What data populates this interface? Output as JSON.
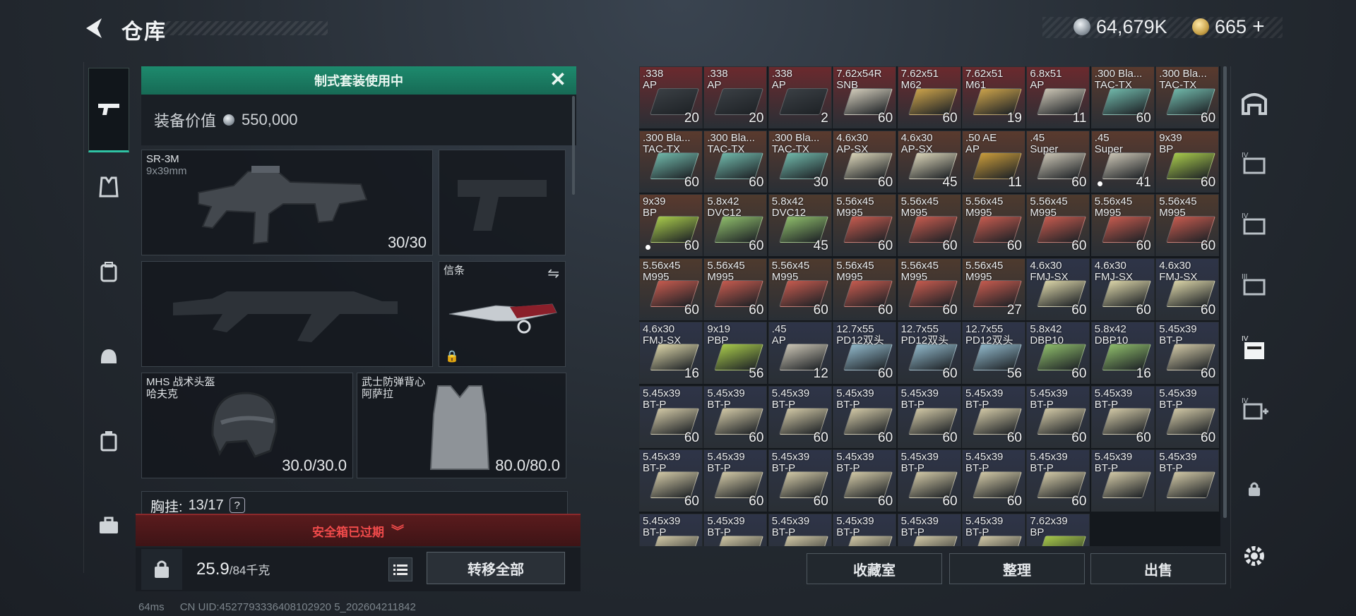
{
  "header": {
    "title": "仓库"
  },
  "currency": {
    "silver": "64,679K",
    "gold": "665",
    "gold_plus": "+"
  },
  "loadout": {
    "banner": "制式套装使用中",
    "value_label": "装备价值",
    "value": "550,000",
    "primary": {
      "name": "SR-3M",
      "caliber": "9x39mm",
      "count": "30/30"
    },
    "melee_label": "信条",
    "helmet": {
      "name": "MHS 战术头盔",
      "sub": "哈夫克",
      "durability": "30.0/30.0"
    },
    "armor": {
      "name": "武士防弹背心",
      "sub": "阿萨拉",
      "durability": "80.0/80.0"
    },
    "rig": {
      "label": "胸挂:",
      "value": "13/17",
      "help": "?"
    },
    "secure_case": "安全箱已过期",
    "weight": "25.9",
    "weight_max": "/84千克",
    "transfer_all": "转移全部"
  },
  "stash": {
    "items": [
      {
        "cal": ".338",
        "typ": "AP",
        "qty": "20",
        "color": "#3a3f44",
        "bg": "#6b2a2e"
      },
      {
        "cal": ".338",
        "typ": "AP",
        "qty": "20",
        "color": "#3a3f44",
        "bg": "#6b2a2e"
      },
      {
        "cal": ".338",
        "typ": "AP",
        "qty": "2",
        "color": "#3a3f44",
        "bg": "#6b2a2e"
      },
      {
        "cal": "7.62x54R",
        "typ": "SNB",
        "qty": "60",
        "color": "#cfc9b8",
        "bg": "#6b2a2e"
      },
      {
        "cal": "7.62x51",
        "typ": "M62",
        "qty": "60",
        "color": "#c9a14a",
        "bg": "#6b2a2e"
      },
      {
        "cal": "7.62x51",
        "typ": "M61",
        "qty": "19",
        "color": "#c9a14a",
        "bg": "#6b2a2e"
      },
      {
        "cal": "6.8x51",
        "typ": "AP",
        "qty": "11",
        "color": "#c8c2b2",
        "bg": "#6b2a2e"
      },
      {
        "cal": ".300 Bla...",
        "typ": "TAC-TX",
        "qty": "60",
        "color": "#6fb6a8",
        "bg": "#5a3a2e"
      },
      {
        "cal": ".300 Bla...",
        "typ": "TAC-TX",
        "qty": "60",
        "color": "#6fb6a8",
        "bg": "#5a3a2e"
      },
      {
        "cal": ".300 Bla...",
        "typ": "TAC-TX",
        "qty": "60",
        "color": "#6fb6a8",
        "bg": "#5a3a2e"
      },
      {
        "cal": ".300 Bla...",
        "typ": "TAC-TX",
        "qty": "60",
        "color": "#6fb6a8",
        "bg": "#5a3a2e"
      },
      {
        "cal": ".300 Bla...",
        "typ": "TAC-TX",
        "qty": "30",
        "color": "#6fb6a8",
        "bg": "#5a3a2e"
      },
      {
        "cal": "4.6x30",
        "typ": "AP-SX",
        "qty": "60",
        "color": "#d8d2b6",
        "bg": "#5a3a2e"
      },
      {
        "cal": "4.6x30",
        "typ": "AP-SX",
        "qty": "45",
        "color": "#d8d2b6",
        "bg": "#5a3a2e"
      },
      {
        "cal": ".50 AE",
        "typ": "AP",
        "qty": "11",
        "color": "#c79a3a",
        "bg": "#5a3a2e"
      },
      {
        "cal": ".45",
        "typ": "Super",
        "qty": "60",
        "color": "#c8c2b2",
        "bg": "#5a3a2e"
      },
      {
        "cal": ".45",
        "typ": "Super",
        "qty": "41",
        "color": "#c8c2b2",
        "bg": "#5a3a2e",
        "dot": true
      },
      {
        "cal": "9x39",
        "typ": "BP",
        "qty": "60",
        "color": "#a6c84a",
        "bg": "#5a3a2e"
      },
      {
        "cal": "9x39",
        "typ": "BP",
        "qty": "60",
        "color": "#a6c84a",
        "bg": "#5a3a2e",
        "dot": true
      },
      {
        "cal": "5.8x42",
        "typ": "DVC12",
        "qty": "60",
        "color": "#8dbb6a",
        "bg": "#4e3a2e"
      },
      {
        "cal": "5.8x42",
        "typ": "DVC12",
        "qty": "45",
        "color": "#8dbb6a",
        "bg": "#4e3a2e"
      },
      {
        "cal": "5.56x45",
        "typ": "M995",
        "qty": "60",
        "color": "#c45a4e",
        "bg": "#4e3a2e"
      },
      {
        "cal": "5.56x45",
        "typ": "M995",
        "qty": "60",
        "color": "#c45a4e",
        "bg": "#4e3a2e"
      },
      {
        "cal": "5.56x45",
        "typ": "M995",
        "qty": "60",
        "color": "#c45a4e",
        "bg": "#4e3a2e"
      },
      {
        "cal": "5.56x45",
        "typ": "M995",
        "qty": "60",
        "color": "#c45a4e",
        "bg": "#4e3a2e"
      },
      {
        "cal": "5.56x45",
        "typ": "M995",
        "qty": "60",
        "color": "#c45a4e",
        "bg": "#4e3a2e"
      },
      {
        "cal": "5.56x45",
        "typ": "M995",
        "qty": "60",
        "color": "#c45a4e",
        "bg": "#4e3a2e"
      },
      {
        "cal": "5.56x45",
        "typ": "M995",
        "qty": "60",
        "color": "#c45a4e",
        "bg": "#4e3a2e"
      },
      {
        "cal": "5.56x45",
        "typ": "M995",
        "qty": "60",
        "color": "#c45a4e",
        "bg": "#4e3a2e"
      },
      {
        "cal": "5.56x45",
        "typ": "M995",
        "qty": "60",
        "color": "#c45a4e",
        "bg": "#4e3a2e"
      },
      {
        "cal": "5.56x45",
        "typ": "M995",
        "qty": "60",
        "color": "#c45a4e",
        "bg": "#4e3a2e"
      },
      {
        "cal": "5.56x45",
        "typ": "M995",
        "qty": "60",
        "color": "#c45a4e",
        "bg": "#4e3a2e"
      },
      {
        "cal": "5.56x45",
        "typ": "M995",
        "qty": "27",
        "color": "#c45a4e",
        "bg": "#4e3a2e"
      },
      {
        "cal": "4.6x30",
        "typ": "FMJ-SX",
        "qty": "60",
        "color": "#d8d2a6",
        "bg": "#2e3448"
      },
      {
        "cal": "4.6x30",
        "typ": "FMJ-SX",
        "qty": "60",
        "color": "#d8d2a6",
        "bg": "#2e3448"
      },
      {
        "cal": "4.6x30",
        "typ": "FMJ-SX",
        "qty": "60",
        "color": "#d8d2a6",
        "bg": "#2e3448"
      },
      {
        "cal": "4.6x30",
        "typ": "FMJ-SX",
        "qty": "16",
        "color": "#d8d2a6",
        "bg": "#2e3448"
      },
      {
        "cal": "9x19",
        "typ": "PBP",
        "qty": "56",
        "color": "#a6c84a",
        "bg": "#2e3448"
      },
      {
        "cal": ".45",
        "typ": "AP",
        "qty": "12",
        "color": "#c8c2b2",
        "bg": "#2e3448"
      },
      {
        "cal": "12.7x55",
        "typ": "PD12双头",
        "qty": "60",
        "color": "#8fb6c8",
        "bg": "#2e3448"
      },
      {
        "cal": "12.7x55",
        "typ": "PD12双头",
        "qty": "60",
        "color": "#8fb6c8",
        "bg": "#2e3448"
      },
      {
        "cal": "12.7x55",
        "typ": "PD12双头",
        "qty": "56",
        "color": "#8fb6c8",
        "bg": "#2e3448"
      },
      {
        "cal": "5.8x42",
        "typ": "DBP10",
        "qty": "60",
        "color": "#8dbb6a",
        "bg": "#2e3448"
      },
      {
        "cal": "5.8x42",
        "typ": "DBP10",
        "qty": "16",
        "color": "#8dbb6a",
        "bg": "#2e3448"
      },
      {
        "cal": "5.45x39",
        "typ": "BT-P",
        "qty": "60",
        "color": "#cfc6a4",
        "bg": "#2e3448"
      },
      {
        "cal": "5.45x39",
        "typ": "BT-P",
        "qty": "60",
        "color": "#cfc6a4",
        "bg": "#2e3448"
      },
      {
        "cal": "5.45x39",
        "typ": "BT-P",
        "qty": "60",
        "color": "#cfc6a4",
        "bg": "#2e3448"
      },
      {
        "cal": "5.45x39",
        "typ": "BT-P",
        "qty": "60",
        "color": "#cfc6a4",
        "bg": "#2e3448"
      },
      {
        "cal": "5.45x39",
        "typ": "BT-P",
        "qty": "60",
        "color": "#cfc6a4",
        "bg": "#2e3448"
      },
      {
        "cal": "5.45x39",
        "typ": "BT-P",
        "qty": "60",
        "color": "#cfc6a4",
        "bg": "#2e3448"
      },
      {
        "cal": "5.45x39",
        "typ": "BT-P",
        "qty": "60",
        "color": "#cfc6a4",
        "bg": "#2e3448"
      },
      {
        "cal": "5.45x39",
        "typ": "BT-P",
        "qty": "60",
        "color": "#cfc6a4",
        "bg": "#2e3448"
      },
      {
        "cal": "5.45x39",
        "typ": "BT-P",
        "qty": "60",
        "color": "#cfc6a4",
        "bg": "#2e3448"
      },
      {
        "cal": "5.45x39",
        "typ": "BT-P",
        "qty": "60",
        "color": "#cfc6a4",
        "bg": "#2e3448"
      },
      {
        "cal": "5.45x39",
        "typ": "BT-P",
        "qty": "60",
        "color": "#cfc6a4",
        "bg": "#2e3448"
      },
      {
        "cal": "5.45x39",
        "typ": "BT-P",
        "qty": "60",
        "color": "#cfc6a4",
        "bg": "#2e3448"
      },
      {
        "cal": "5.45x39",
        "typ": "BT-P",
        "qty": "60",
        "color": "#cfc6a4",
        "bg": "#2e3448"
      },
      {
        "cal": "5.45x39",
        "typ": "BT-P",
        "qty": "60",
        "color": "#cfc6a4",
        "bg": "#2e3448"
      },
      {
        "cal": "5.45x39",
        "typ": "BT-P",
        "qty": "60",
        "color": "#cfc6a4",
        "bg": "#2e3448"
      },
      {
        "cal": "5.45x39",
        "typ": "BT-P",
        "qty": "60",
        "color": "#cfc6a4",
        "bg": "#2e3448"
      },
      {
        "cal": "5.45x39",
        "typ": "BT-P",
        "qty": "60",
        "color": "#cfc6a4",
        "bg": "#2e3448"
      },
      {
        "cal": "5.45x39",
        "typ": "BT-P",
        "qty": "",
        "color": "#cfc6a4",
        "bg": "#2e3448"
      },
      {
        "cal": "5.45x39",
        "typ": "BT-P",
        "qty": "",
        "color": "#cfc6a4",
        "bg": "#2e3448"
      },
      {
        "cal": "5.45x39",
        "typ": "BT-P",
        "qty": "",
        "color": "#cfc6a4",
        "bg": "#2e3448"
      },
      {
        "cal": "5.45x39",
        "typ": "BT-P",
        "qty": "",
        "color": "#cfc6a4",
        "bg": "#2e3448"
      },
      {
        "cal": "5.45x39",
        "typ": "BT-P",
        "qty": "",
        "color": "#cfc6a4",
        "bg": "#2e3448"
      },
      {
        "cal": "5.45x39",
        "typ": "BT-P",
        "qty": "",
        "color": "#cfc6a4",
        "bg": "#2e3448"
      },
      {
        "cal": "5.45x39",
        "typ": "BT-P",
        "qty": "",
        "color": "#cfc6a4",
        "bg": "#2e3448"
      },
      {
        "cal": "5.45x39",
        "typ": "BT-P",
        "qty": "",
        "color": "#cfc6a4",
        "bg": "#2e3448"
      },
      {
        "cal": "7.62x39",
        "typ": "BP",
        "qty": "",
        "color": "#a6c84a",
        "bg": "#2e3448"
      }
    ]
  },
  "actions": {
    "collection": "收藏室",
    "organize": "整理",
    "sell": "出售"
  },
  "footer": {
    "ping": "64ms",
    "uid": "CN UID:4527793336408102920 5_202604211842"
  }
}
